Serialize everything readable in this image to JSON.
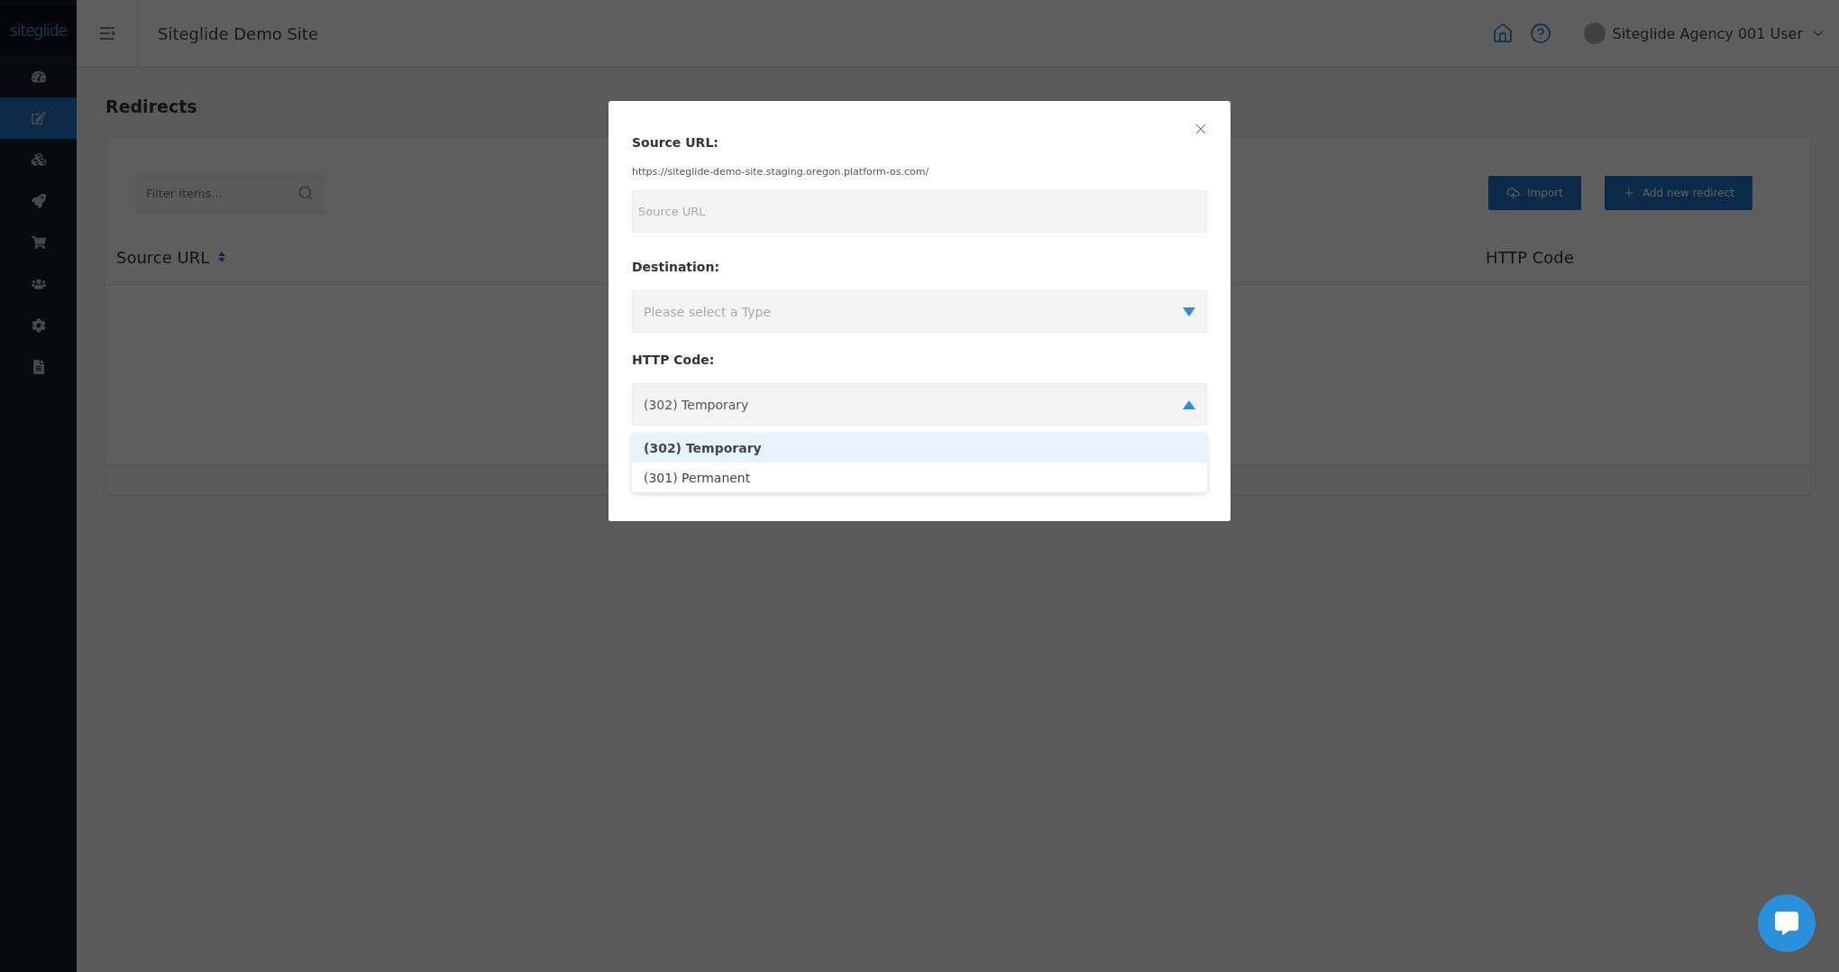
{
  "sidebar": {
    "logo": "siteglide",
    "items": [
      {
        "selected": false
      },
      {
        "selected": true
      },
      {
        "selected": false
      },
      {
        "selected": false
      },
      {
        "selected": false
      },
      {
        "selected": false
      },
      {
        "selected": false
      },
      {
        "selected": false
      }
    ]
  },
  "header": {
    "site_title": "Siteglide Demo Site",
    "user_name": "Siteglide Agency 001 User"
  },
  "page": {
    "title": "Redirects",
    "filter": {
      "placeholder": "Filter items..."
    },
    "buttons": [
      {
        "label": "Import",
        "kind": "import"
      },
      {
        "label": "Add new redirect",
        "kind": "add"
      }
    ],
    "table": {
      "columns": [
        {
          "label": "Source URL",
          "sortable": true
        },
        {
          "label": "HTTP Code",
          "sortable": false
        }
      ]
    }
  },
  "modal": {
    "fields": [
      {
        "kind": "text",
        "label": "Source URL:",
        "hint": "https://siteglide-demo-site.staging.oregon.platform-os.com/",
        "placeholder": "Source URL"
      },
      {
        "kind": "select",
        "label": "Destination:",
        "placeholder": "Please select a Type",
        "expanded": false
      },
      {
        "kind": "select",
        "label": "HTTP Code:",
        "value": "(302) Temporary",
        "expanded": true,
        "options": [
          {
            "label": "(302) Temporary",
            "selected": true
          },
          {
            "label": "(301) Permanent",
            "selected": false
          }
        ]
      }
    ]
  }
}
